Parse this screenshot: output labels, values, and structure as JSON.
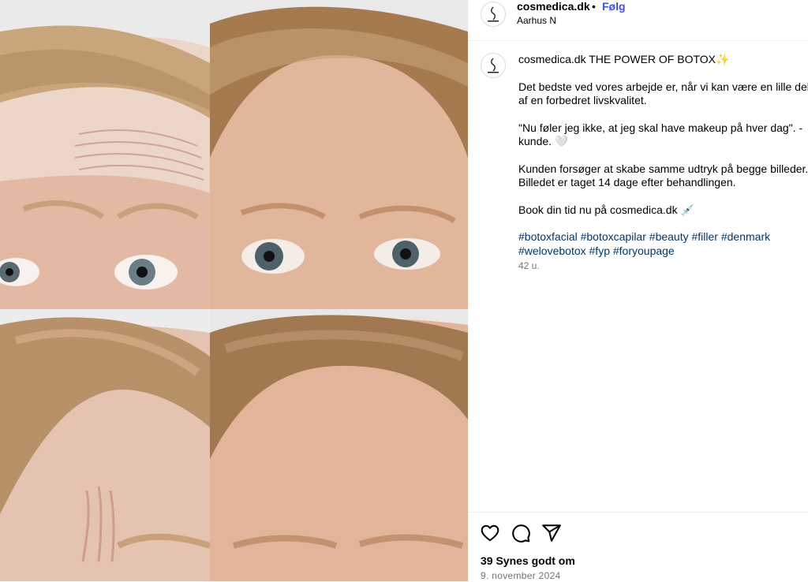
{
  "post": {
    "username": "cosmedica.dk",
    "separator": "•",
    "follow_label": "Følg",
    "location": "Aarhus N",
    "avatar_icon": "cosmedica-logo-icon"
  },
  "caption": {
    "username": "cosmedica.dk",
    "title": "THE POWER OF BOTOX✨",
    "paragraphs": [
      "Det bedste ved vores arbejde er, når vi kan være en lille del af en forbedret livskvalitet.",
      "\"Nu føler jeg ikke, at jeg skal have makeup på hver dag\". - kunde. 🤍",
      "Kunden forsøger at skabe samme udtryk på begge billeder. Billedet er taget 14 dage efter behandlingen.",
      "Book din tid nu på cosmedica.dk 💉"
    ],
    "hashtags": [
      "#botoxfacial",
      "#botoxcapilar",
      "#beauty",
      "#filler",
      "#denmark",
      "#welovebotox",
      "#fyp",
      "#foryoupage"
    ],
    "time_ago": "42 u."
  },
  "actions": {
    "like_icon": "heart-icon",
    "comment_icon": "comment-icon",
    "share_icon": "share-icon",
    "likes_text": "39 Synes godt om",
    "date": "9. november 2024"
  },
  "colors": {
    "follow": "#4150f7",
    "hashtag": "#00376b",
    "muted": "#737373",
    "border": "#efefef"
  }
}
